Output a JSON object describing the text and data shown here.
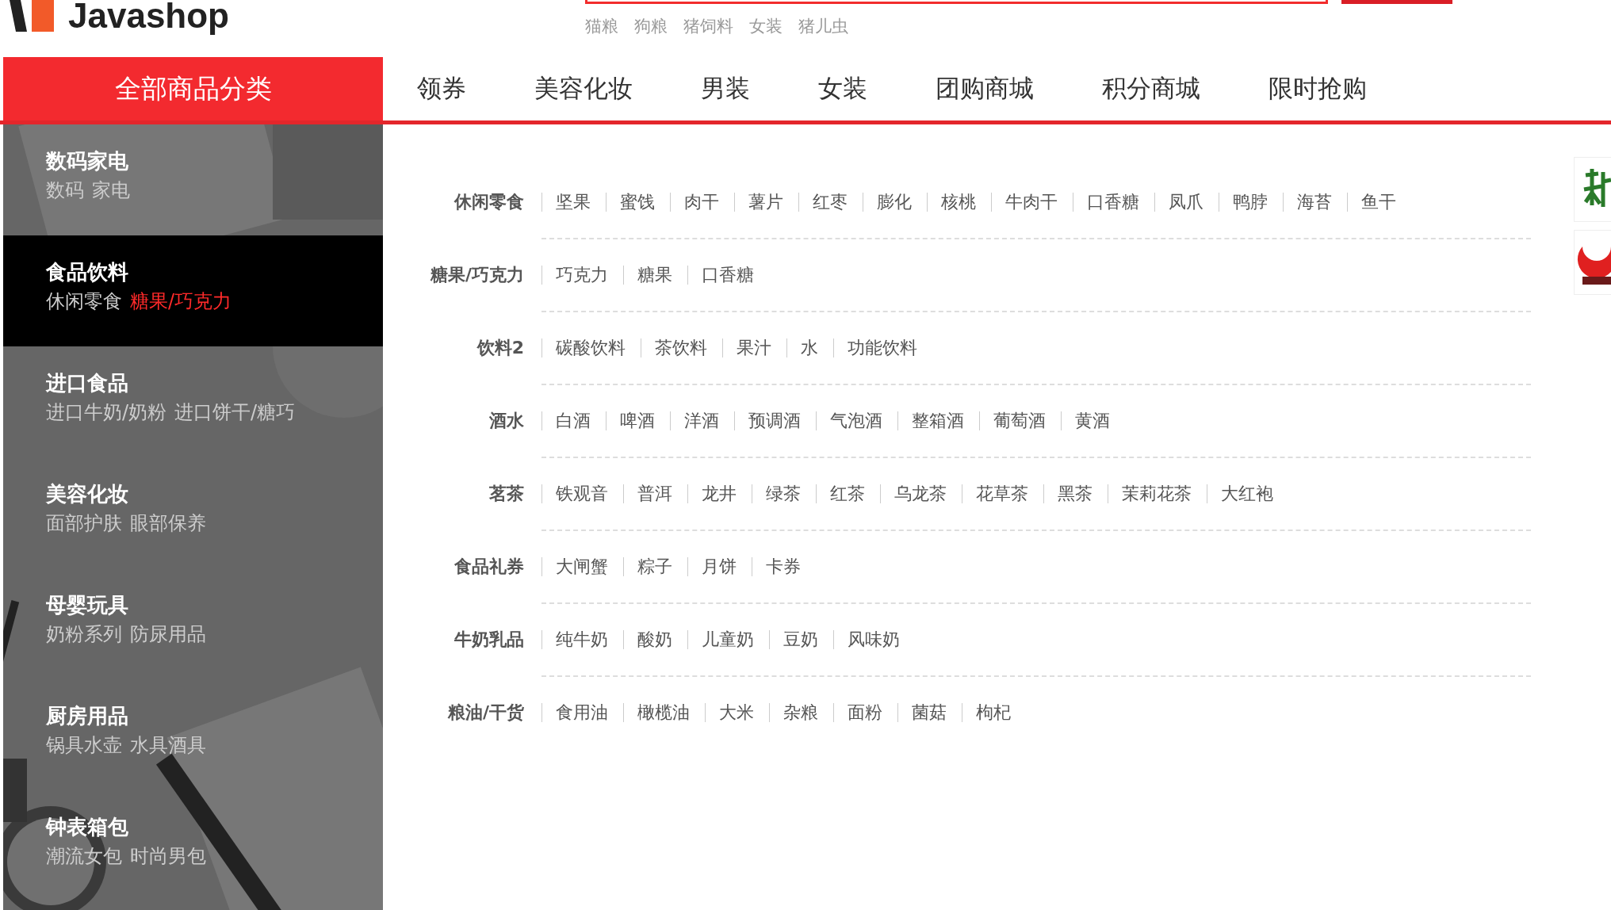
{
  "logo": {
    "text": "Javashop"
  },
  "hot_words": [
    "猫粮",
    "狗粮",
    "猪饲料",
    "女装",
    "猪儿虫"
  ],
  "nav": {
    "category_button": "全部商品分类",
    "links": [
      "领券",
      "美容化妆",
      "男装",
      "女装",
      "团购商城",
      "积分商城",
      "限时抢购"
    ]
  },
  "sidebar": {
    "items": [
      {
        "title": "数码家电",
        "selected": false,
        "subs": [
          {
            "label": "数码",
            "highlighted": false
          },
          {
            "label": "家电",
            "highlighted": false
          }
        ]
      },
      {
        "title": "食品饮料",
        "selected": true,
        "subs": [
          {
            "label": "休闲零食",
            "highlighted": false
          },
          {
            "label": "糖果/巧克力",
            "highlighted": true
          }
        ]
      },
      {
        "title": "进口食品",
        "selected": false,
        "subs": [
          {
            "label": "进口牛奶/奶粉",
            "highlighted": false
          },
          {
            "label": "进口饼干/糖巧",
            "highlighted": false
          }
        ]
      },
      {
        "title": "美容化妆",
        "selected": false,
        "subs": [
          {
            "label": "面部护肤",
            "highlighted": false
          },
          {
            "label": "眼部保养",
            "highlighted": false
          }
        ]
      },
      {
        "title": "母婴玩具",
        "selected": false,
        "subs": [
          {
            "label": "奶粉系列",
            "highlighted": false
          },
          {
            "label": "防尿用品",
            "highlighted": false
          }
        ]
      },
      {
        "title": "厨房用品",
        "selected": false,
        "subs": [
          {
            "label": "锅具水壶",
            "highlighted": false
          },
          {
            "label": "水具酒具",
            "highlighted": false
          }
        ]
      },
      {
        "title": "钟表箱包",
        "selected": false,
        "subs": [
          {
            "label": "潮流女包",
            "highlighted": false
          },
          {
            "label": "时尚男包",
            "highlighted": false
          }
        ]
      }
    ]
  },
  "submenu": [
    {
      "label": "休闲零食",
      "items": [
        "坚果",
        "蜜饯",
        "肉干",
        "薯片",
        "红枣",
        "膨化",
        "核桃",
        "牛肉干",
        "口香糖",
        "凤爪",
        "鸭脖",
        "海苔",
        "鱼干"
      ]
    },
    {
      "label": "糖果/巧克力",
      "items": [
        "巧克力",
        "糖果",
        "口香糖"
      ]
    },
    {
      "label": "饮料2",
      "items": [
        "碳酸饮料",
        "茶饮料",
        "果汁",
        "水",
        "功能饮料"
      ]
    },
    {
      "label": "酒水",
      "items": [
        "白酒",
        "啤酒",
        "洋酒",
        "预调酒",
        "气泡酒",
        "整箱酒",
        "葡萄酒",
        "黄酒"
      ]
    },
    {
      "label": "茗茶",
      "items": [
        "铁观音",
        "普洱",
        "龙井",
        "绿茶",
        "红茶",
        "乌龙茶",
        "花草茶",
        "黑茶",
        "茉莉花茶",
        "大红袍"
      ]
    },
    {
      "label": "食品礼券",
      "items": [
        "大闸蟹",
        "粽子",
        "月饼",
        "卡券"
      ]
    },
    {
      "label": "牛奶乳品",
      "items": [
        "纯牛奶",
        "酸奶",
        "儿童奶",
        "豆奶",
        "风味奶"
      ]
    },
    {
      "label": "粮油/干货",
      "items": [
        "食用油",
        "橄榄油",
        "大米",
        "杂粮",
        "面粉",
        "菌菇",
        "枸杞"
      ]
    }
  ]
}
